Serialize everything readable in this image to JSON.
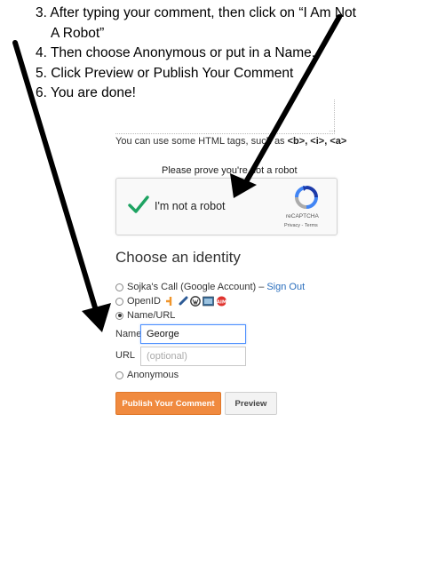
{
  "instructions": [
    "3.  After typing your comment, then click on “I Am Not",
    "A Robot”",
    "4.  Then choose Anonymous or put in a Name.",
    "5.  Click Preview or Publish Your Comment",
    "6. You are done!"
  ],
  "comment": {
    "html_tags_prefix": "You can use some HTML tags, such as",
    "html_tags_examples": "<b>, <i>, <a>"
  },
  "captcha": {
    "prompt": "Please prove you're not a robot",
    "label": "I'm not a robot",
    "brand": "reCAPTCHA",
    "privacy_terms": "Privacy - Terms",
    "checked": true
  },
  "identity": {
    "heading": "Choose an identity",
    "options": [
      {
        "label": "Sojka's Call (Google Account) –",
        "link": "Sign Out",
        "selected": false
      },
      {
        "label": "OpenID",
        "selected": false
      },
      {
        "label": "Name/URL",
        "selected": true
      },
      {
        "label": "Anonymous",
        "selected": false
      }
    ],
    "openid_icons": [
      "blogger-icon",
      "livejournal-icon",
      "wordpress-icon",
      "typepad-icon",
      "aim-icon"
    ],
    "name_label": "Name",
    "name_value": "George",
    "url_label": "URL",
    "url_placeholder": "(optional)"
  },
  "buttons": {
    "publish": "Publish Your Comment",
    "preview": "Preview"
  },
  "colors": {
    "link": "#2a6ebd",
    "publish_button": "#f08a3f",
    "checkmark": "#1ea362",
    "focus_border": "#4d90fe",
    "arrow": "#000000"
  }
}
